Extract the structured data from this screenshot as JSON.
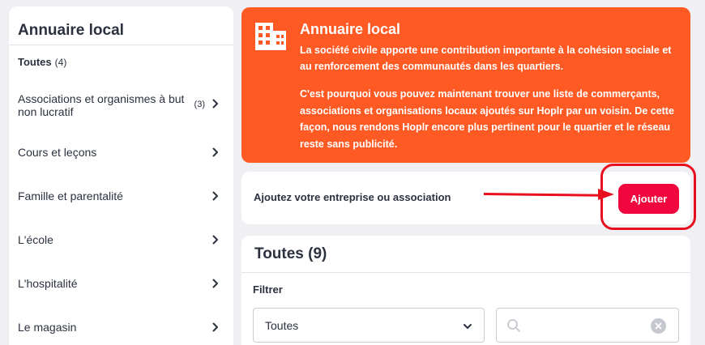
{
  "sidebar": {
    "title": "Annuaire local",
    "all": {
      "label": "Toutes",
      "count": "(4)"
    },
    "items": [
      {
        "label": "Associations et organismes à but non lucratif",
        "count": "(3)"
      },
      {
        "label": "Cours et leçons",
        "count": ""
      },
      {
        "label": "Famille et parentalité",
        "count": ""
      },
      {
        "label": "L'école",
        "count": ""
      },
      {
        "label": "L'hospitalité",
        "count": ""
      },
      {
        "label": "Le magasin",
        "count": ""
      }
    ]
  },
  "banner": {
    "icon": "building-icon",
    "title": "Annuaire local",
    "paragraph1": "La société civile apporte une contribution importante à la cohésion sociale et au renforcement des communautés dans les quartiers.",
    "paragraph2": "C'est pourquoi vous pouvez maintenant trouver une liste de commerçants, associations et organisations locaux ajoutés sur Hoplr par un voisin. De cette façon, nous rendons Hoplr encore plus pertinent pour le quartier et le réseau reste sans publicité."
  },
  "add_card": {
    "text": "Ajoutez votre entreprise ou association",
    "button_label": "Ajouter"
  },
  "list": {
    "title": "Toutes (9)",
    "filter_label": "Filtrer",
    "select_value": "Toutes",
    "search_value": "",
    "search_placeholder": ""
  },
  "colors": {
    "accent_orange": "#ff5a24",
    "button_red": "#f0073d",
    "annotation_red": "#e8101e",
    "background": "#f0f0f4",
    "text_dark": "#2c3140"
  }
}
